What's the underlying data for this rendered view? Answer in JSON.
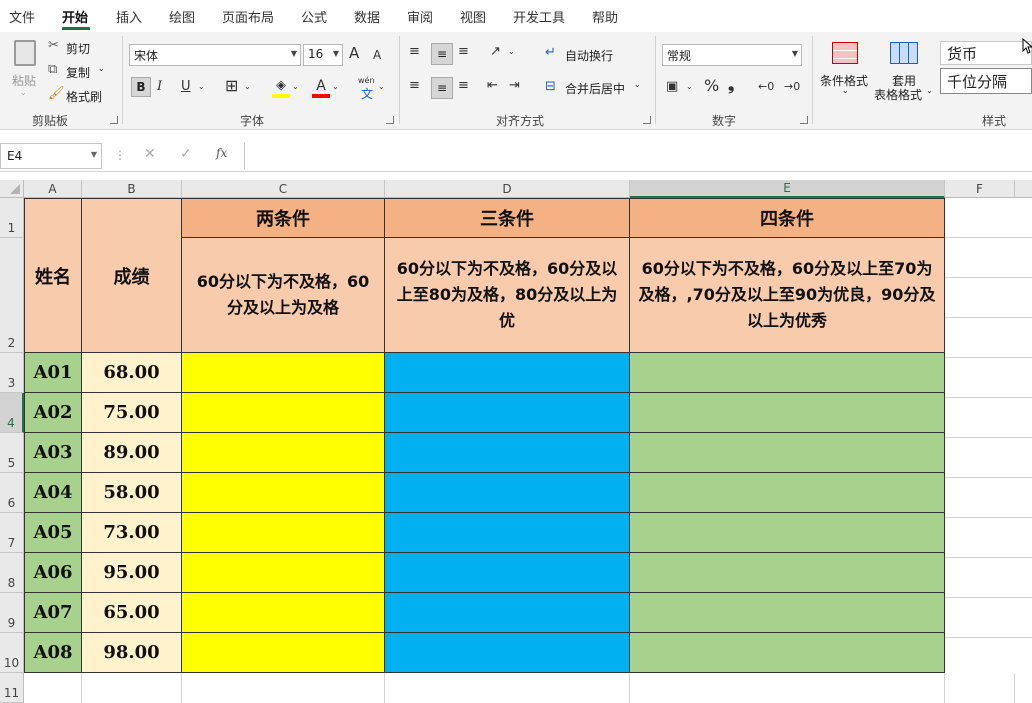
{
  "tabs": [
    "文件",
    "开始",
    "插入",
    "绘图",
    "页面布局",
    "公式",
    "数据",
    "审阅",
    "视图",
    "开发工具",
    "帮助"
  ],
  "ribbon": {
    "clipboard": {
      "paste": "粘贴",
      "cut": "剪切",
      "copy": "复制",
      "format_painter": "格式刷",
      "label": "剪贴板"
    },
    "font": {
      "name": "宋体",
      "size": "16",
      "bold": "B",
      "italic": "I",
      "underline": "U",
      "grow": "A",
      "shrink": "A",
      "label": "字体",
      "wen": "wén",
      "wen_char": "文"
    },
    "align": {
      "wrap": "自动换行",
      "merge": "合并后居中",
      "label": "对齐方式"
    },
    "number": {
      "format": "常规",
      "percent": "%",
      "comma": "❟",
      "label": "数字"
    },
    "styles": {
      "cond_format": "条件格式",
      "table_format_1": "套用",
      "table_format_2": "表格格式",
      "currency": "货币",
      "thousands": "千位分隔",
      "label": "样式"
    }
  },
  "formula_bar": {
    "name_box": "E4",
    "fx": "fx",
    "cancel": "✕",
    "enter": "✓",
    "value": ""
  },
  "columns": [
    "A",
    "B",
    "C",
    "D",
    "E",
    "F"
  ],
  "rows": [
    "1",
    "2",
    "3",
    "4",
    "5",
    "6",
    "7",
    "8",
    "9",
    "10",
    "11"
  ],
  "header": {
    "name": "姓名",
    "score": "成绩",
    "c1": "两条件",
    "c2": "三条件",
    "c3": "四条件",
    "cond1": "60分以下为不及格，60分及以上为及格",
    "cond2": "60分以下为不及格，60分及以上至80为及格，80分及以上为优",
    "cond3": "60分以下为不及格，60分及以上至70为及格，,70分及以上至90为优良，90分及以上为优秀"
  },
  "data": [
    {
      "name": "A01",
      "score": "68.00"
    },
    {
      "name": "A02",
      "score": "75.00"
    },
    {
      "name": "A03",
      "score": "89.00"
    },
    {
      "name": "A04",
      "score": "58.00"
    },
    {
      "name": "A05",
      "score": "73.00"
    },
    {
      "name": "A06",
      "score": "95.00"
    },
    {
      "name": "A07",
      "score": "65.00"
    },
    {
      "name": "A08",
      "score": "98.00"
    }
  ],
  "colors": {
    "accent": "#217346",
    "header_orange": "#f4b183",
    "header_light": "#f8cbad",
    "name_green": "#a9d18e",
    "score_cream": "#fff2cc",
    "c_yellow": "#ffff00",
    "d_blue": "#00b0f0",
    "e_green": "#a9d18e"
  }
}
